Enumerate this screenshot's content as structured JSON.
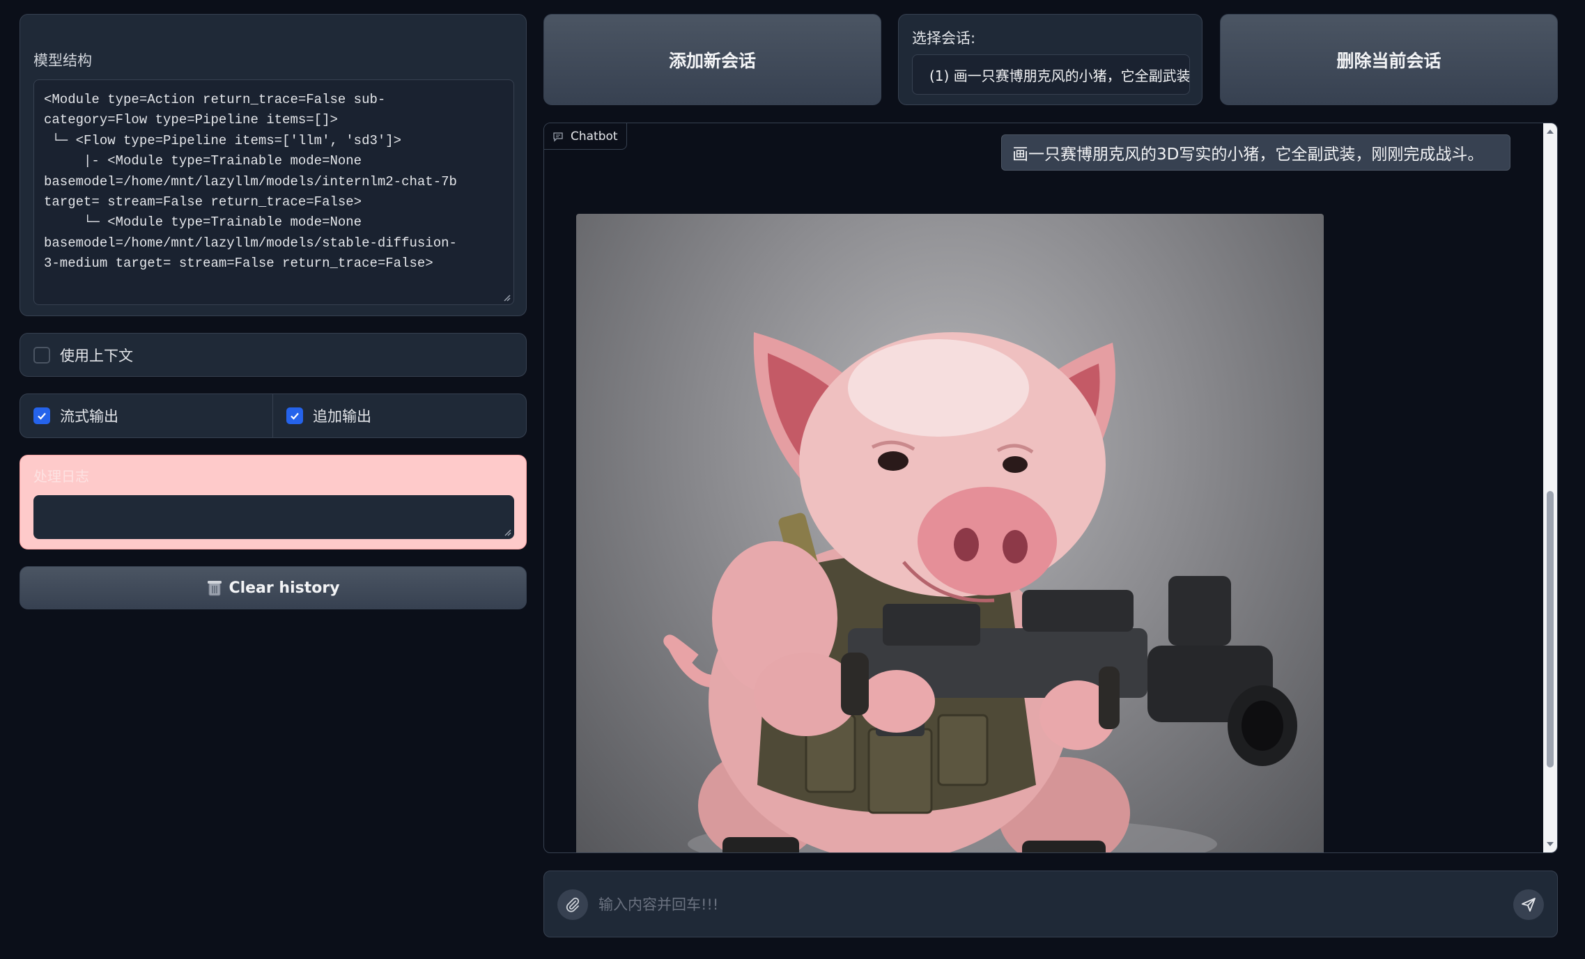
{
  "left": {
    "model_structure": {
      "label": "模型结构",
      "lines": [
        "<Module type=Action return_trace=False sub-",
        "category=Flow type=Pipeline items=[]>",
        " └─ <Flow type=Pipeline items=['llm', 'sd3']>",
        "     |- <Module type=Trainable mode=None",
        "basemodel=/home/mnt/lazyllm/models/internlm2-chat-7b",
        "target= stream=False return_trace=False>",
        "     └─ <Module type=Trainable mode=None",
        "basemodel=/home/mnt/lazyllm/models/stable-diffusion-",
        "3-medium target= stream=False return_trace=False>"
      ]
    },
    "use_context": {
      "label": "使用上下文",
      "checked": false
    },
    "stream_output": {
      "label": "流式输出",
      "checked": true
    },
    "append_output": {
      "label": "追加输出",
      "checked": true
    },
    "log": {
      "label": "处理日志",
      "value": ""
    },
    "clear_history": {
      "label": "Clear history",
      "icon": "trash-icon"
    }
  },
  "top": {
    "add_session_label": "添加新会话",
    "select_session": {
      "label": "选择会话:",
      "value": "(1) 画一只赛博朋克风的小猪，它全副武装"
    },
    "delete_session_label": "删除当前会话"
  },
  "chatbot": {
    "tab_label": "Chatbot",
    "user_message": "画一只赛博朋克风的3D写实的小猪，它全副武装，刚刚完成战斗。",
    "image_subject": "armored-pig-with-rifle"
  },
  "input": {
    "placeholder": "输入内容并回车!!!",
    "value": ""
  },
  "colors": {
    "background": "#0b0f19",
    "panel": "#1f2937",
    "accent": "#2563eb",
    "log_bg": "#fecaca"
  }
}
